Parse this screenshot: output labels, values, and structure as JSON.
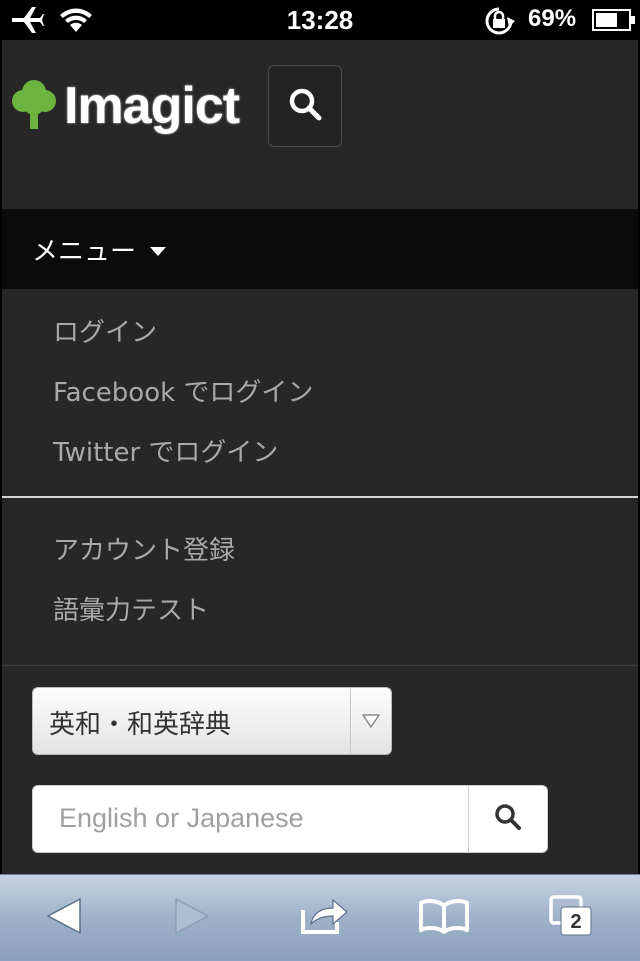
{
  "status_bar": {
    "time": "13:28",
    "battery_percent": "69%",
    "battery_level": 0.69
  },
  "header": {
    "logo_text": "Imagict",
    "logo_color": "#6db33f"
  },
  "menu": {
    "toggle_label": "メニュー",
    "items_group1": [
      "ログイン",
      "Facebook でログイン",
      "Twitter でログイン"
    ],
    "items_group2": [
      "アカウント登録",
      "語彙力テスト"
    ]
  },
  "search": {
    "dictionary_selected": "英和・和英辞典",
    "placeholder": "English or Japanese",
    "value": ""
  },
  "toolbar": {
    "tab_count": "2"
  }
}
